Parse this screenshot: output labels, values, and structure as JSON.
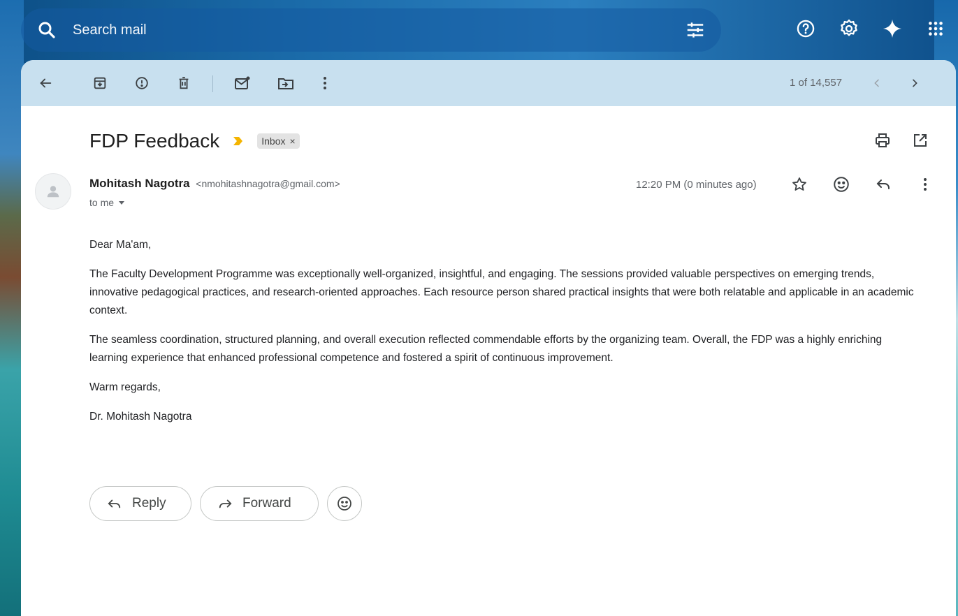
{
  "search": {
    "placeholder": "Search mail"
  },
  "toolbar": {
    "pager": "1 of 14,557"
  },
  "message": {
    "subject": "FDP Feedback",
    "label": "Inbox",
    "label_close": "×",
    "sender_name": "Mohitash Nagotra",
    "sender_email": "<nmohitashnagotra@gmail.com>",
    "to": "to me",
    "time": "12:20 PM (0 minutes ago)",
    "body": [
      "Dear Ma'am,",
      "The Faculty Development Programme was exceptionally well-organized, insightful, and engaging. The sessions provided valuable perspectives on emerging trends, innovative pedagogical practices, and research-oriented approaches. Each resource person shared practical insights that were both relatable and applicable in an academic context.",
      "The seamless coordination, structured planning, and overall execution reflected commendable efforts by the organizing team. Overall, the FDP was a highly enriching learning experience that enhanced professional competence and fostered a spirit of continuous improvement.",
      "Warm regards,",
      "Dr. Mohitash Nagotra"
    ]
  },
  "actions": {
    "reply": "Reply",
    "forward": "Forward"
  },
  "colors": {
    "toolbar_bg": "#c8e0ef",
    "importance": "#f4b400"
  }
}
